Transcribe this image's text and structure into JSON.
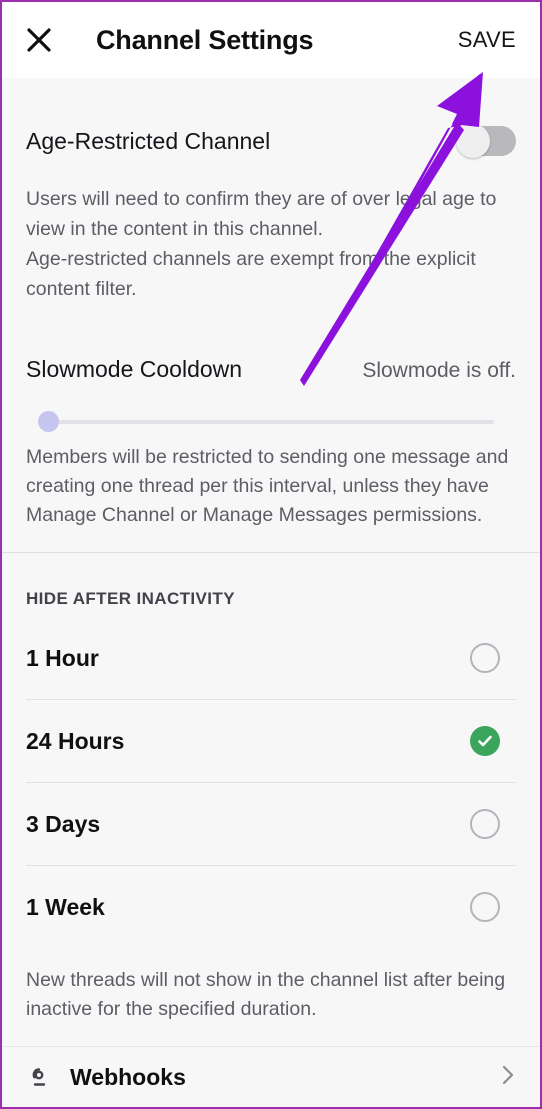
{
  "header": {
    "close_icon": "close-icon",
    "title": "Channel Settings",
    "save_label": "SAVE"
  },
  "age_restricted": {
    "label": "Age-Restricted Channel",
    "toggle_state": "off",
    "description": "Users will need to confirm they are of over legal age to\nview in the content in this channel.\nAge-restricted channels are exempt from the explicit\ncontent filter."
  },
  "slowmode": {
    "label": "Slowmode Cooldown",
    "value_text": "Slowmode is off.",
    "slider_position_percent": 0,
    "description": "Members will be restricted to sending one message and\ncreating one thread per this interval, unless they have\nManage Channel or Manage Messages permissions."
  },
  "hide_after_inactivity": {
    "section_title": "HIDE AFTER INACTIVITY",
    "options": [
      {
        "label": "1 Hour",
        "selected": false
      },
      {
        "label": "24 Hours",
        "selected": true
      },
      {
        "label": "3 Days",
        "selected": false
      },
      {
        "label": "1 Week",
        "selected": false
      }
    ],
    "description": "New threads will not show in the channel list after being\ninactive for the specified duration."
  },
  "webhooks": {
    "icon": "webhook-icon",
    "label": "Webhooks",
    "chevron_icon": "chevron-right-icon"
  },
  "annotation": {
    "type": "arrow",
    "color": "#8c11dd",
    "points_to": "SAVE"
  },
  "colors": {
    "accent_green": "#3ba55c",
    "annotation_purple": "#8c11dd",
    "border_purple": "#9b2fb0",
    "background": "#f7f7f8",
    "header_background": "#ffffff"
  }
}
